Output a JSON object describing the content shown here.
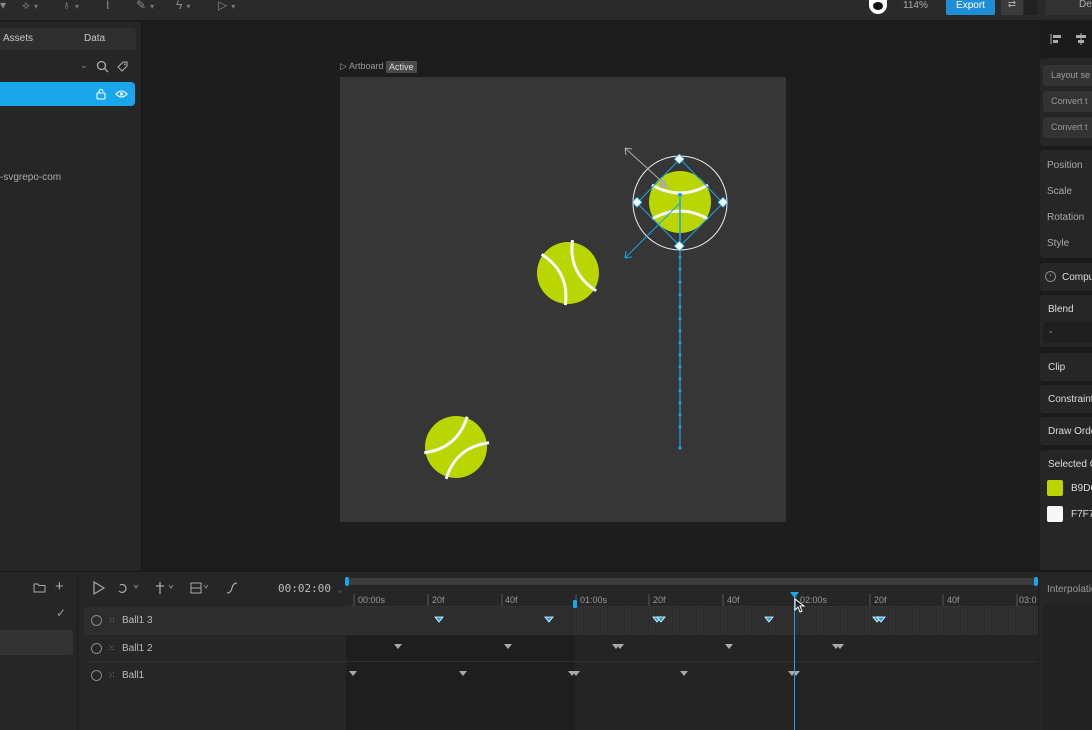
{
  "toolbar": {
    "zoom": "114%",
    "export_label": "Export",
    "design_tab": "De"
  },
  "left_panel": {
    "tab_assets": "Assets",
    "tab_data": "Data",
    "asset_name": "-svgrepo-com"
  },
  "artboard": {
    "label": "Artboard",
    "state": "Active"
  },
  "right_panel": {
    "buttons": [
      "Layout se",
      "Convert t",
      "Convert t"
    ],
    "labels": [
      "Position",
      "Scale",
      "Rotation",
      "Style"
    ],
    "computed": "Compu",
    "blend": "Blend",
    "blend_value": "-",
    "clip": "Clip",
    "constraints": "Constraint",
    "draw_order": "Draw Orde",
    "selected_colors": "Selected C",
    "colors": [
      {
        "hex": "B9D6",
        "color": "#b9d600"
      },
      {
        "hex": "F7F7",
        "color": "#f7f7f7"
      }
    ]
  },
  "timeline": {
    "timecode": "00:02:00",
    "interpolation": "Interpolatio",
    "ticks": [
      {
        "label": "00:00s"
      },
      {
        "label": "20f"
      },
      {
        "label": "40f"
      },
      {
        "label": "01:00s"
      },
      {
        "label": "20f"
      },
      {
        "label": "40f"
      },
      {
        "label": "02:00s"
      },
      {
        "label": "20f"
      },
      {
        "label": "40f"
      },
      {
        "label": "03:0"
      }
    ],
    "layers": [
      {
        "name": "Ball1 3"
      },
      {
        "name": "Ball1 2"
      },
      {
        "name": "Ball1"
      }
    ]
  },
  "colors": {
    "accent": "#1aa6ea",
    "ball": "#b9d600"
  }
}
